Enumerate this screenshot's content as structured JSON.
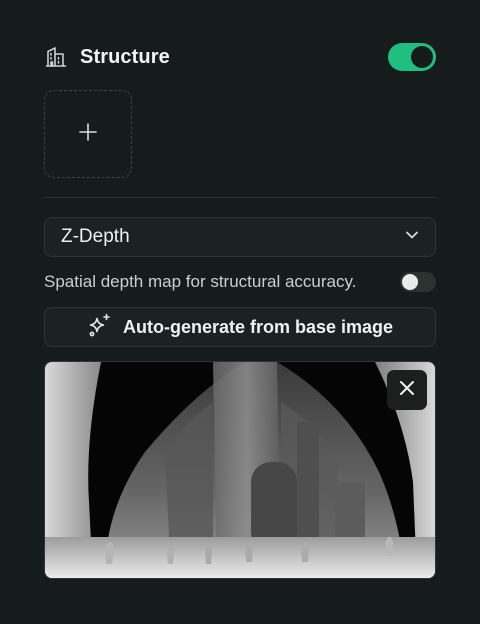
{
  "header": {
    "icon": "building-icon",
    "title": "Structure",
    "enabled": true
  },
  "add_tile": {
    "icon": "plus-icon"
  },
  "mode_select": {
    "value": "Z-Depth",
    "icon": "chevron-down-icon"
  },
  "description": {
    "text": "Spatial depth map for structural accuracy.",
    "toggle_on": false
  },
  "auto_generate": {
    "icon": "sparkles-icon",
    "label": "Auto-generate from base image"
  },
  "preview": {
    "kind": "grayscale depth map",
    "remove_icon": "close-icon"
  },
  "colors": {
    "background": "#161c1b",
    "accent": "#1fbf7f",
    "surface": "#1b2221",
    "border": "#2d3634",
    "text": "#eef2f1"
  }
}
